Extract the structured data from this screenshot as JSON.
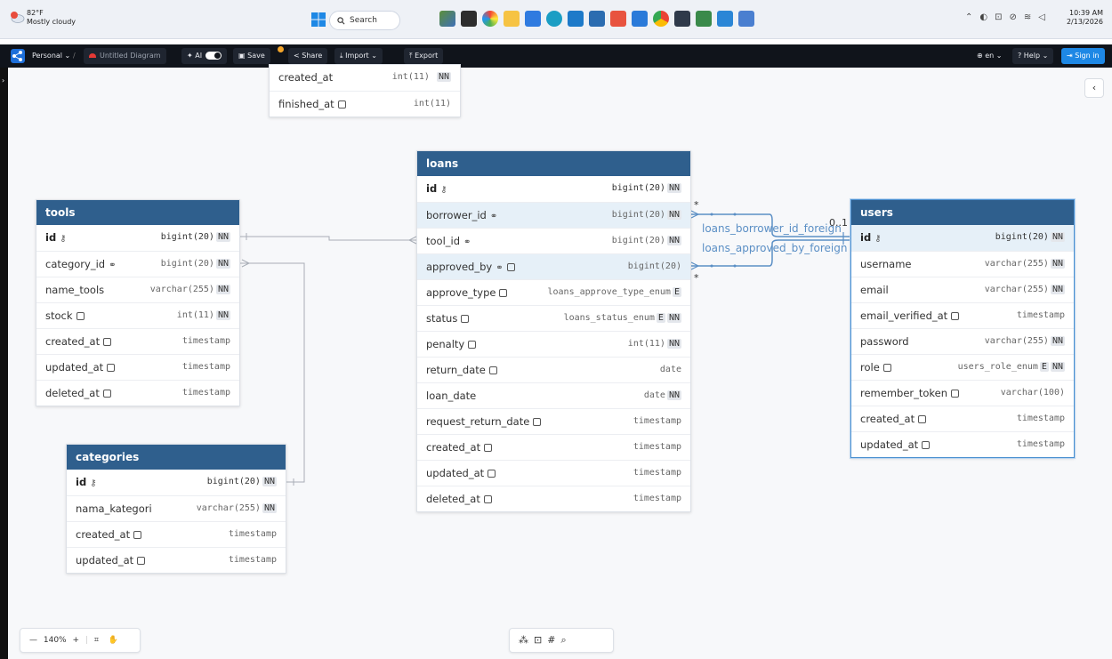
{
  "taskbar": {
    "weather_temp": "82°F",
    "weather_desc": "Mostly cloudy",
    "weather_badge": "2",
    "search_label": "Search",
    "time": "10:39 AM",
    "date": "2/13/2026"
  },
  "appbar": {
    "workspace": "Personal ⌄",
    "separator": "/",
    "diagram_name": "Untitled Diagram",
    "ai_label": "AI",
    "save_label": "Save",
    "share_label": "Share",
    "import_label": "Import ⌄",
    "export_label": "Export",
    "lang_label": "en ⌄",
    "help_label": "? Help ⌄",
    "signin_label": "Sign in"
  },
  "partial_table": {
    "rows": [
      {
        "name": "created_at",
        "type": "int(11)",
        "nn": "NN"
      },
      {
        "name": "finished_at",
        "type": "int(11)",
        "nn": ""
      }
    ]
  },
  "tables": {
    "tools": {
      "title": "tools",
      "rows": [
        {
          "name": "id",
          "type": "bigint(20)",
          "nn": "NN"
        },
        {
          "name": "category_id",
          "type": "bigint(20)",
          "nn": "NN"
        },
        {
          "name": "name_tools",
          "type": "varchar(255)",
          "nn": "NN"
        },
        {
          "name": "stock",
          "type": "int(11)",
          "nn": "NN"
        },
        {
          "name": "created_at",
          "type": "timestamp",
          "nn": ""
        },
        {
          "name": "updated_at",
          "type": "timestamp",
          "nn": ""
        },
        {
          "name": "deleted_at",
          "type": "timestamp",
          "nn": ""
        }
      ]
    },
    "categories": {
      "title": "categories",
      "rows": [
        {
          "name": "id",
          "type": "bigint(20)",
          "nn": "NN"
        },
        {
          "name": "nama_kategori",
          "type": "varchar(255)",
          "nn": "NN"
        },
        {
          "name": "created_at",
          "type": "timestamp",
          "nn": ""
        },
        {
          "name": "updated_at",
          "type": "timestamp",
          "nn": ""
        }
      ]
    },
    "loans": {
      "title": "loans",
      "rows": [
        {
          "name": "id",
          "type": "bigint(20)",
          "nn": "NN"
        },
        {
          "name": "borrower_id",
          "type": "bigint(20)",
          "nn": "NN"
        },
        {
          "name": "tool_id",
          "type": "bigint(20)",
          "nn": "NN"
        },
        {
          "name": "approved_by",
          "type": "bigint(20)",
          "nn": ""
        },
        {
          "name": "approve_type",
          "type": "loans_approve_type_enum",
          "nn": "E"
        },
        {
          "name": "status",
          "type": "loans_status_enum",
          "nn": "E NN"
        },
        {
          "name": "penalty",
          "type": "int(11)",
          "nn": "NN"
        },
        {
          "name": "return_date",
          "type": "date",
          "nn": ""
        },
        {
          "name": "loan_date",
          "type": "date",
          "nn": "NN"
        },
        {
          "name": "request_return_date",
          "type": "timestamp",
          "nn": ""
        },
        {
          "name": "created_at",
          "type": "timestamp",
          "nn": ""
        },
        {
          "name": "updated_at",
          "type": "timestamp",
          "nn": ""
        },
        {
          "name": "deleted_at",
          "type": "timestamp",
          "nn": ""
        }
      ]
    },
    "users": {
      "title": "users",
      "rows": [
        {
          "name": "id",
          "type": "bigint(20)",
          "nn": "NN"
        },
        {
          "name": "username",
          "type": "varchar(255)",
          "nn": "NN"
        },
        {
          "name": "email",
          "type": "varchar(255)",
          "nn": "NN"
        },
        {
          "name": "email_verified_at",
          "type": "timestamp",
          "nn": ""
        },
        {
          "name": "password",
          "type": "varchar(255)",
          "nn": "NN"
        },
        {
          "name": "role",
          "type": "users_role_enum",
          "nn": "E NN"
        },
        {
          "name": "remember_token",
          "type": "varchar(100)",
          "nn": ""
        },
        {
          "name": "created_at",
          "type": "timestamp",
          "nn": ""
        },
        {
          "name": "updated_at",
          "type": "timestamp",
          "nn": ""
        }
      ]
    }
  },
  "relations": {
    "borrower_label": "loans_borrower_id_foreign",
    "approved_label": "loans_approved_by_foreign",
    "many": "*",
    "one": "0..1"
  },
  "controls": {
    "zoom_level": "140%"
  }
}
